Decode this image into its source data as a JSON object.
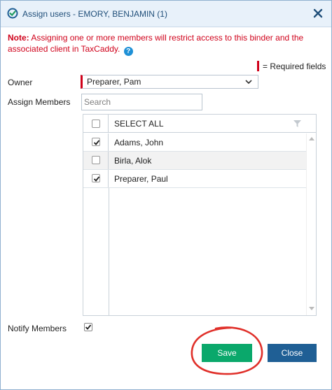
{
  "dialog": {
    "title": "Assign users",
    "title_client": "- EMORY, BENJAMIN (1)",
    "note_label": "Note:",
    "note_text": "Assigning one or more members will restrict access to this binder and the associated client in TaxCaddy.",
    "help_icon": "?",
    "required_legend": "= Required fields"
  },
  "form": {
    "owner_label": "Owner",
    "owner_value": "Preparer, Pam",
    "assign_label": "Assign Members",
    "search_placeholder": "Search",
    "notify_label": "Notify Members",
    "notify_checked": true
  },
  "grid": {
    "select_all_label": "SELECT ALL",
    "rows": [
      {
        "name": "Adams, John",
        "checked": true
      },
      {
        "name": "Birla, Alok",
        "checked": false
      },
      {
        "name": "Preparer, Paul",
        "checked": true
      }
    ]
  },
  "buttons": {
    "save": "Save",
    "close": "Close"
  },
  "icons": {
    "title_icon": "check-circle-icon",
    "close_icon": "close-icon",
    "owner_dropdown": "chevron-down-icon",
    "filter": "filter-icon"
  },
  "colors": {
    "title_text": "#1f4e79",
    "note": "#d0021b",
    "required_bar": "#d0021b",
    "save_button": "#0aa86b",
    "close_button": "#1f5f95",
    "annotation": "#e0302a"
  }
}
